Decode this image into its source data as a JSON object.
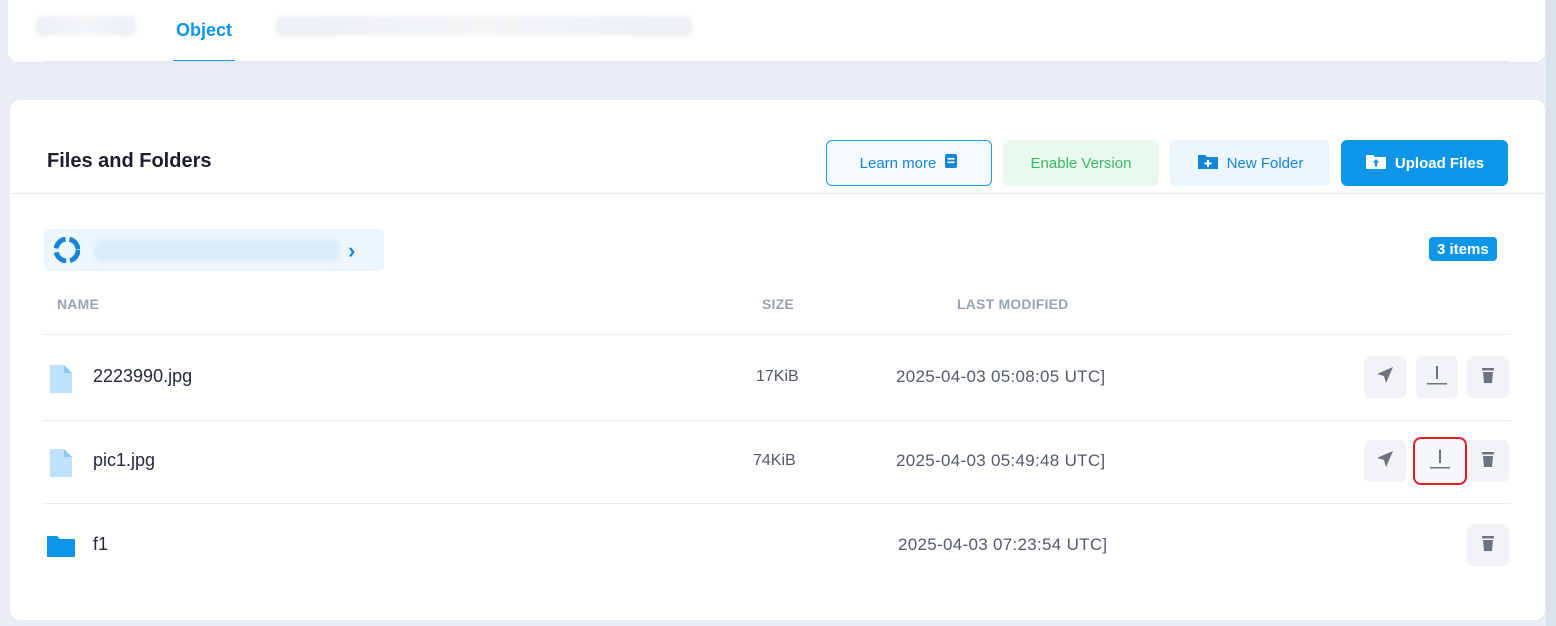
{
  "tabs": {
    "active_label": "Object"
  },
  "header": {
    "title": "Files and Folders",
    "learn_more": "Learn more",
    "enable_version": "Enable Version",
    "new_folder": "New Folder",
    "upload_files": "Upload Files"
  },
  "breadcrumb": {
    "items_count": "3 items"
  },
  "table": {
    "columns": {
      "name": "NAME",
      "size": "SIZE",
      "last_modified": "LAST MODIFIED"
    },
    "rows": [
      {
        "name": "2223990.jpg",
        "size": "17KiB",
        "modified": "2025-04-03 05:08:05 UTC]",
        "type": "file"
      },
      {
        "name": "pic1.jpg",
        "size": "74KiB",
        "modified": "2025-04-03 05:49:48 UTC]",
        "type": "file"
      },
      {
        "name": "f1",
        "size": "",
        "modified": "2025-04-03 07:23:54 UTC]",
        "type": "folder"
      }
    ]
  },
  "colors": {
    "accent": "#0d95e8",
    "success": "#3cb768",
    "highlight": "#e02020"
  }
}
